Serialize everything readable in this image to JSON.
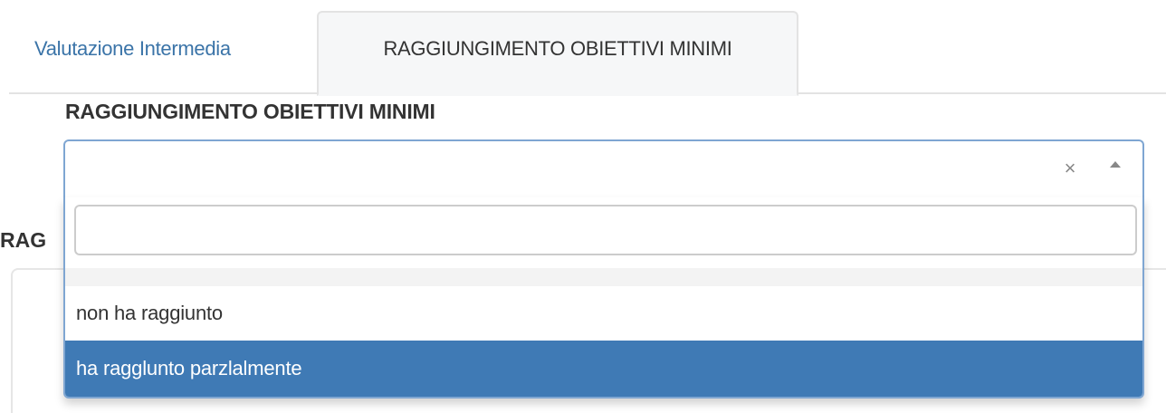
{
  "tabs": [
    {
      "label": "Valutazione Intermedia",
      "active": false
    },
    {
      "label": "RAGGIUNGIMENTO OBIETTIVI MINIMI",
      "active": true
    }
  ],
  "field": {
    "label": "RAGGIUNGIMENTO OBIETTIVI MINIMI",
    "selected_value": "",
    "clear_icon": "×",
    "arrow_icon": "chevron-up-icon"
  },
  "dropdown": {
    "search_value": "",
    "options": [
      {
        "label": "",
        "highlighted": false
      },
      {
        "label": "non ha raggiunto",
        "highlighted": false
      },
      {
        "label": "ha ragglunto parzlalmente",
        "highlighted": true
      }
    ]
  },
  "background": {
    "section_label_partial": "RAG"
  },
  "colors": {
    "tab_link": "#3b74a8",
    "highlight": "#3f7ab5",
    "focus_border": "#7fa6d2"
  }
}
